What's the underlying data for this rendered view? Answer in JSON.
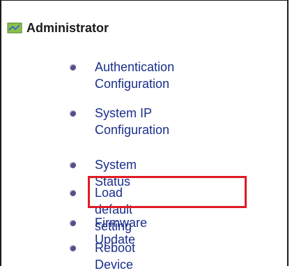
{
  "header": {
    "title": "Administrator",
    "icon": "admin-icon"
  },
  "menu": [
    {
      "label": "Authentication Configuration"
    },
    {
      "label": "System IP Configuration"
    },
    {
      "label": "System Status"
    },
    {
      "label": "Load default setting"
    },
    {
      "label": "Firmware Update"
    },
    {
      "label": "Reboot Device"
    }
  ],
  "colors": {
    "link": "#1a2f8a",
    "bullet": "#5a4b8a",
    "highlight": "#e11b22"
  }
}
